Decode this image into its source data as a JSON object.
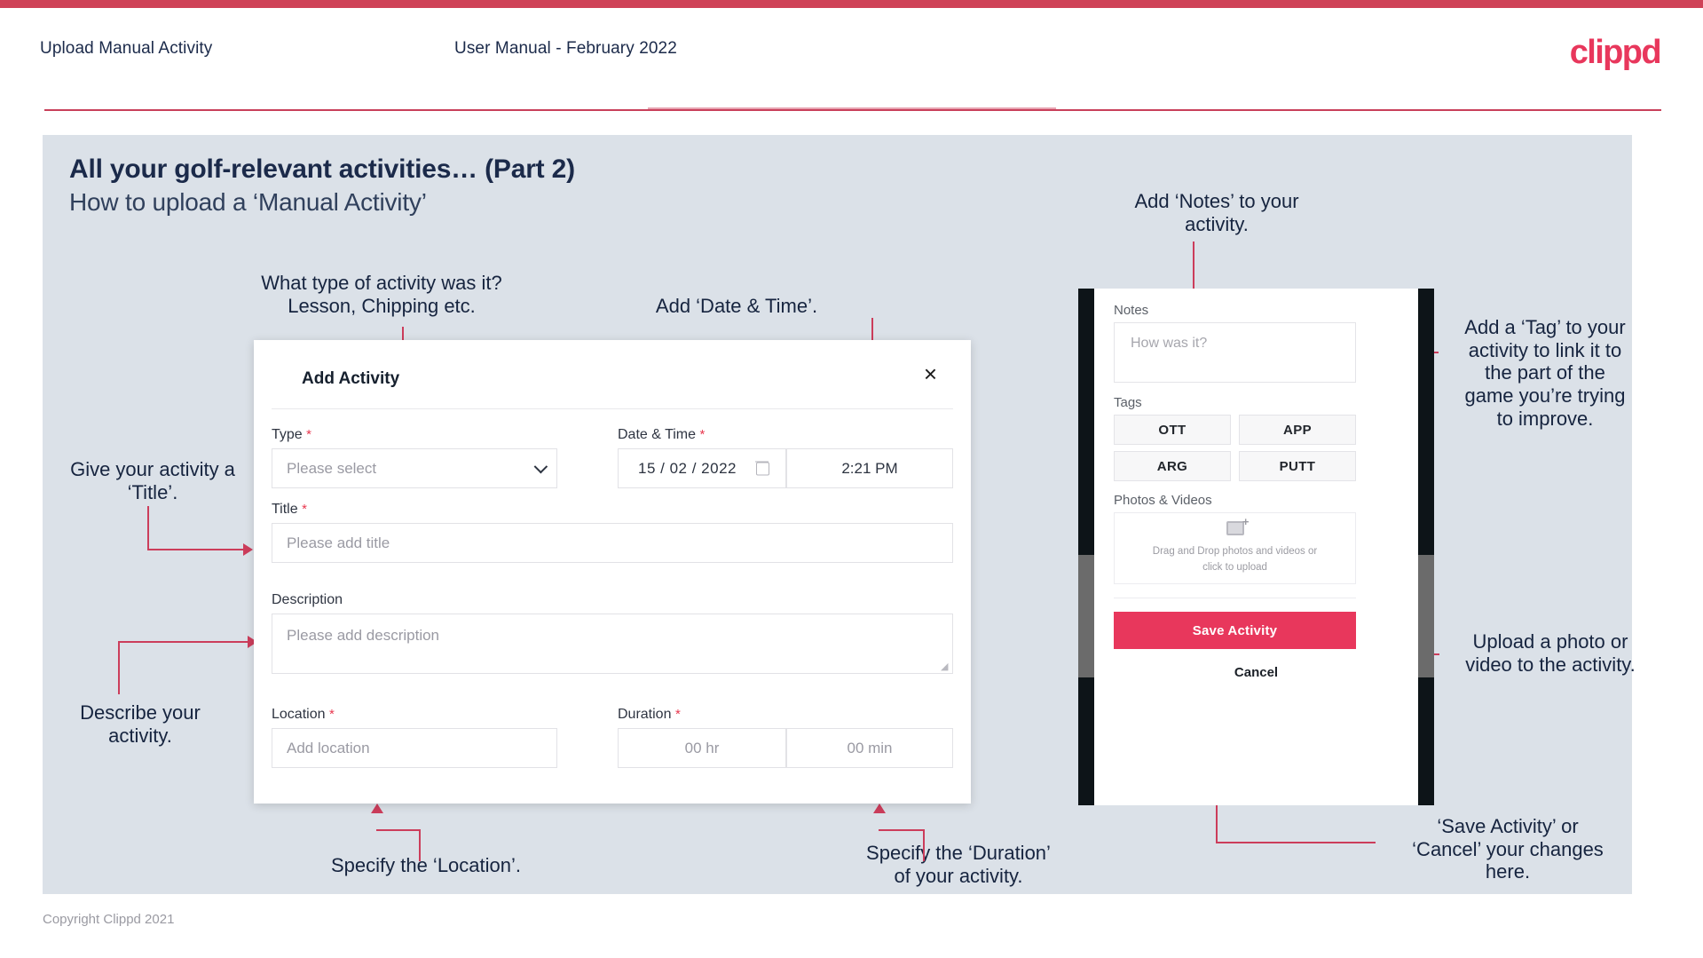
{
  "header": {
    "title": "Upload Manual Activity",
    "subtitle": "User Manual - February 2022",
    "logo": "clippd"
  },
  "slide": {
    "title": "All your golf-relevant activities… (Part 2)",
    "subtitle": "How to upload a ‘Manual Activity’"
  },
  "dialog": {
    "title": "Add Activity",
    "close_icon": "×",
    "type": {
      "label": "Type",
      "required": "*",
      "placeholder": "Please select"
    },
    "datetime": {
      "label": "Date & Time",
      "required": "*",
      "date": "15 /  02  / 2022",
      "time": "2:21 PM"
    },
    "title_field": {
      "label": "Title",
      "required": "*",
      "placeholder": "Please add title"
    },
    "description": {
      "label": "Description",
      "placeholder": "Please add description"
    },
    "location": {
      "label": "Location",
      "required": "*",
      "placeholder": "Add location"
    },
    "duration": {
      "label": "Duration",
      "required": "*",
      "hours": "00 hr",
      "minutes": "00 min"
    }
  },
  "phone": {
    "notes_label": "Notes",
    "notes_placeholder": "How was it?",
    "tags_label": "Tags",
    "tags": [
      "OTT",
      "APP",
      "ARG",
      "PUTT"
    ],
    "photos_label": "Photos & Videos",
    "dropzone_line1": "Drag and Drop photos and videos or",
    "dropzone_line2": "click to upload",
    "save_label": "Save Activity",
    "cancel_label": "Cancel"
  },
  "annotations": {
    "type": "What type of activity was it?\nLesson, Chipping etc.",
    "datetime": "Add ‘Date & Time’.",
    "title": "Give your activity a\n‘Title’.",
    "description": "Describe your\nactivity.",
    "location": "Specify the ‘Location’.",
    "duration": "Specify the ‘Duration’\nof your activity.",
    "notes": "Add ‘Notes’ to your\nactivity.",
    "tags": "Add a ‘Tag’ to your\nactivity to link it to\nthe part of the\ngame you’re trying\nto improve.",
    "upload": "Upload a photo or\nvideo to the activity.",
    "save": "‘Save Activity’ or\n‘Cancel’ your changes\nhere."
  },
  "footer": {
    "copyright": "Copyright Clippd 2021"
  },
  "colors": {
    "accent": "#e8375c",
    "stripe": "#cf4257",
    "slide_bg": "#dbe1e8",
    "text_dark": "#16243f",
    "connector": "#cc3d5b"
  }
}
